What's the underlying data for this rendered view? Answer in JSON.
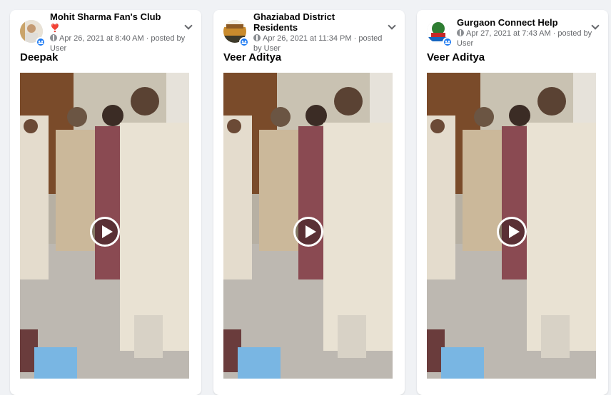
{
  "colors": {
    "page_bg": "#f0f2f5",
    "card_bg": "#ffffff",
    "primary_text": "#050505",
    "secondary_text": "#65676b",
    "group_badge": "#1877f2"
  },
  "posts": [
    {
      "group_name": "Mohit Sharma Fan's Club",
      "group_emoji": "❣️",
      "timestamp": "Apr 26, 2021 at 8:40 AM",
      "posted_by": "· posted by User",
      "poster_name": "Deepak",
      "avatar_icon": "group-avatar-icon",
      "media_type": "video",
      "play_icon": "play-icon"
    },
    {
      "group_name": "Ghaziabad District Residents",
      "group_emoji": "",
      "timestamp": "Apr 26, 2021 at 11:34 PM",
      "posted_by": "· posted by User",
      "poster_name": "Veer Aditya",
      "avatar_icon": "group-avatar-icon",
      "media_type": "video",
      "play_icon": "play-icon"
    },
    {
      "group_name": "Gurgaon Connect Help",
      "group_emoji": "",
      "timestamp": "Apr 27, 2021 at 7:43 AM",
      "posted_by": "· posted by User",
      "poster_name": "Veer Aditya",
      "avatar_icon": "group-avatar-icon",
      "media_type": "video",
      "play_icon": "play-icon"
    }
  ]
}
